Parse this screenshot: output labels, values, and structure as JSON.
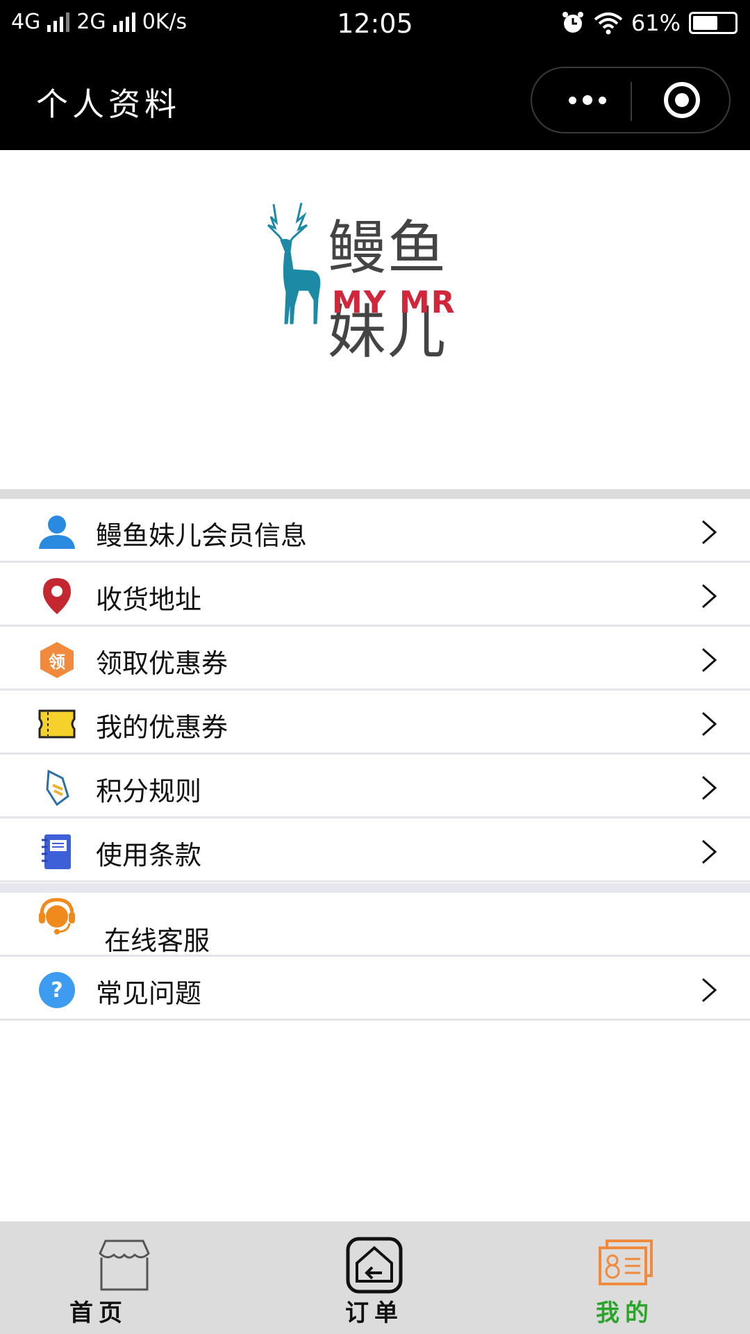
{
  "status_bar": {
    "network1": "4G",
    "network2": "2G",
    "speed": "0K/s",
    "time": "12:05",
    "battery": "61%",
    "battery_level": 0.61
  },
  "header": {
    "title": "个人资料"
  },
  "logo": {
    "name_cn": "鳗鱼妹儿",
    "name_en": "MY MR",
    "deer_color": "#1d8aa5",
    "en_color": "#d2263a"
  },
  "menu_main": [
    {
      "label": "鳗鱼妹儿会员信息",
      "icon": "user-icon"
    },
    {
      "label": "收货地址",
      "icon": "location-pin-icon"
    },
    {
      "label": "领取优惠券",
      "icon": "coupon-claim-icon",
      "icon_text": "领"
    },
    {
      "label": "我的优惠券",
      "icon": "ticket-icon"
    },
    {
      "label": "积分规则",
      "icon": "scroll-icon"
    },
    {
      "label": "使用条款",
      "icon": "notebook-icon"
    }
  ],
  "menu_support": [
    {
      "label": "在线客服",
      "icon": "headset-icon"
    },
    {
      "label": "常见问题",
      "icon": "question-icon",
      "icon_text": "?"
    }
  ],
  "tabs": [
    {
      "label": "首页",
      "icon": "store-icon",
      "active": false
    },
    {
      "label": "订单",
      "icon": "order-box-icon",
      "active": false
    },
    {
      "label": "我的",
      "icon": "profile-card-icon",
      "active": true
    }
  ],
  "colors": {
    "tab_active": "#2aa52a",
    "tab_active_icon": "#f08a3c",
    "tab_inactive": "#111111"
  }
}
